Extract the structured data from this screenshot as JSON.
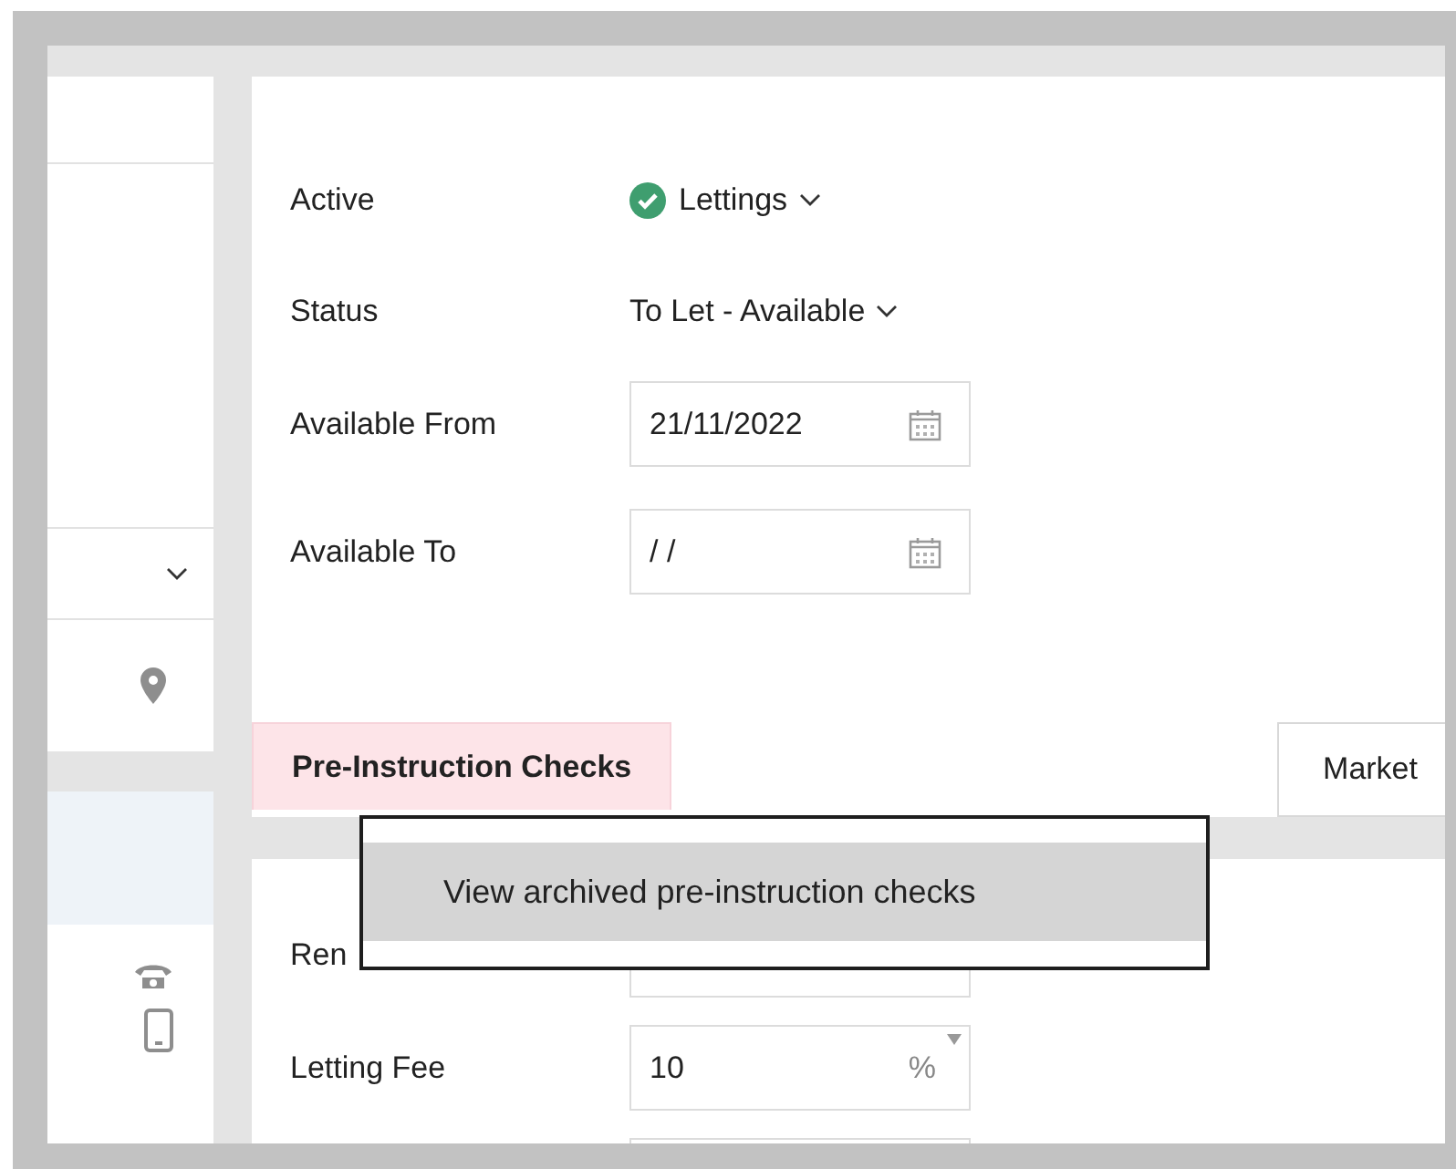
{
  "details": {
    "fields": [
      {
        "label": "Active",
        "kind": "dropdown",
        "value": "Lettings",
        "checked": true
      },
      {
        "label": "Status",
        "kind": "dropdown",
        "value": "To Let - Available"
      },
      {
        "label": "Available From",
        "kind": "date",
        "value": "21/11/2022"
      },
      {
        "label": "Available To",
        "kind": "date",
        "value": "/ /"
      }
    ]
  },
  "tabs": [
    {
      "label": "Pre-Instruction Checks",
      "selected": true
    },
    {
      "label": "Market",
      "selected": false
    }
  ],
  "fees": {
    "fields": [
      {
        "label": "Ren",
        "kind": "text"
      },
      {
        "label": "Letting Fee",
        "kind": "percent",
        "value": "10",
        "unit": "%"
      },
      {
        "kind": "text"
      }
    ]
  },
  "context_menu": {
    "items": [
      {
        "label": "View archived pre-instruction checks",
        "selected": true
      }
    ]
  }
}
